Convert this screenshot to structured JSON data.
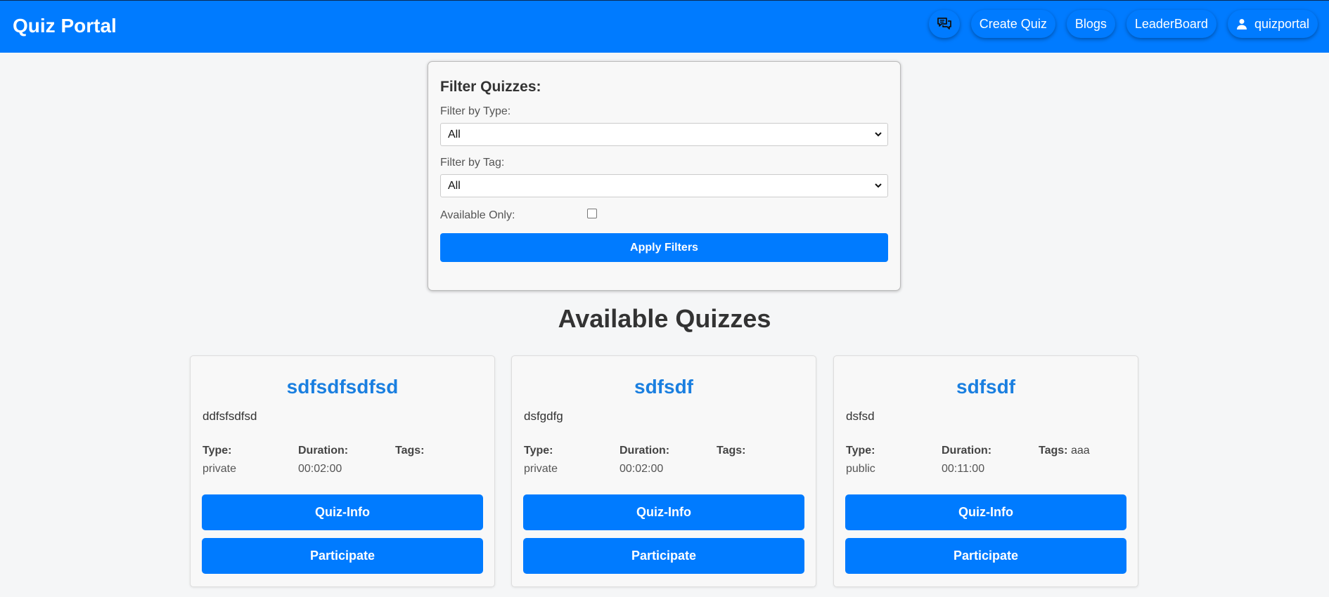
{
  "navbar": {
    "brand": "Quiz Portal",
    "items": [
      {
        "label": "Create Quiz"
      },
      {
        "label": "Blogs"
      },
      {
        "label": "LeaderBoard"
      },
      {
        "label": "quizportal"
      }
    ],
    "chat_icon": "chat-bubbles-icon",
    "user_icon": "user-icon"
  },
  "filters": {
    "title": "Filter Quizzes:",
    "type_label": "Filter by Type:",
    "type_value": "All",
    "tag_label": "Filter by Tag:",
    "tag_value": "All",
    "available_label": "Available Only:",
    "available_checked": false,
    "apply_label": "Apply Filters"
  },
  "section_title": "Available Quizzes",
  "quizzes": [
    {
      "title": "sdfsdfsdfsd",
      "description": "ddfsfsdfsd",
      "type": "private",
      "duration": "00:02:00",
      "tags": ""
    },
    {
      "title": "sdfsdf",
      "description": "dsfgdfg",
      "type": "private",
      "duration": "00:02:00",
      "tags": ""
    },
    {
      "title": "sdfsdf",
      "description": "dsfsd",
      "type": "public",
      "duration": "00:11:00",
      "tags": "aaa"
    }
  ],
  "labels": {
    "type": "Type:",
    "duration": "Duration:",
    "tags": "Tags:",
    "info_button": "Quiz-Info",
    "participate_button": "Participate"
  },
  "colors": {
    "primary": "#007bff",
    "title_blue": "#1a7fe0",
    "background": "#f5f6f7"
  }
}
